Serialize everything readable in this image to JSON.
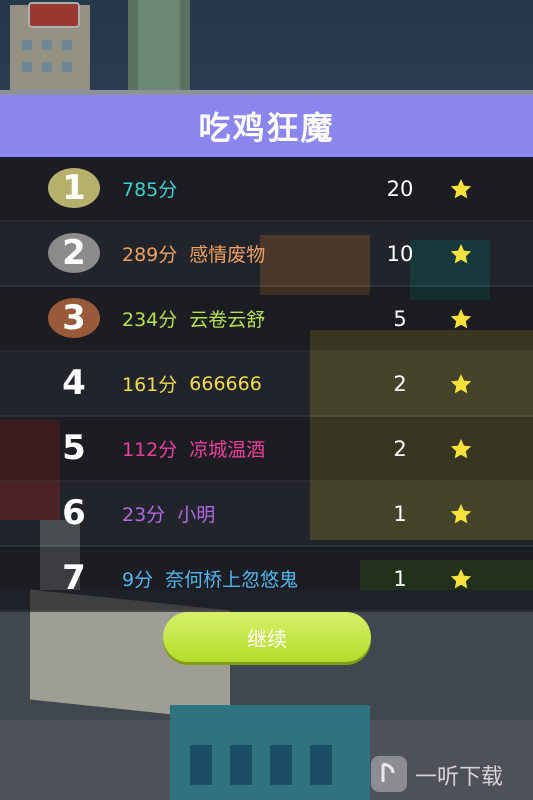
{
  "title": "吃鸡狂魔",
  "colors": {
    "title_bar": "#8a86ee",
    "rank_gold": "#b7b06a",
    "rank_silver": "#8b8b8b",
    "rank_bronze": "#9a5a3a",
    "star": "#f6e23a",
    "button": "#c6e83f"
  },
  "leaderboard": [
    {
      "rank": "1",
      "score": "785分",
      "name": "",
      "count": "20",
      "color": "#3fd0d0",
      "star_icon": "star-icon"
    },
    {
      "rank": "2",
      "score": "289分",
      "name": "感情废物",
      "count": "10",
      "color": "#f0a060",
      "star_icon": "star-icon"
    },
    {
      "rank": "3",
      "score": "234分",
      "name": "云卷云舒",
      "count": "5",
      "color": "#b8e04a",
      "star_icon": "star-icon"
    },
    {
      "rank": "4",
      "score": "161分",
      "name": "666666",
      "count": "2",
      "color": "#f2dc4a",
      "star_icon": "star-icon"
    },
    {
      "rank": "5",
      "score": "112分",
      "name": "凉城温酒",
      "count": "2",
      "color": "#ee3e9c",
      "star_icon": "star-icon"
    },
    {
      "rank": "6",
      "score": "23分",
      "name": "小明",
      "count": "1",
      "color": "#b468e0",
      "star_icon": "star-icon"
    },
    {
      "rank": "7",
      "score": "9分",
      "name": "奈何桥上忽悠鬼",
      "count": "1",
      "color": "#4fb6f0",
      "star_icon": "star-icon"
    }
  ],
  "continue_label": "继续",
  "watermark": "一听下载"
}
